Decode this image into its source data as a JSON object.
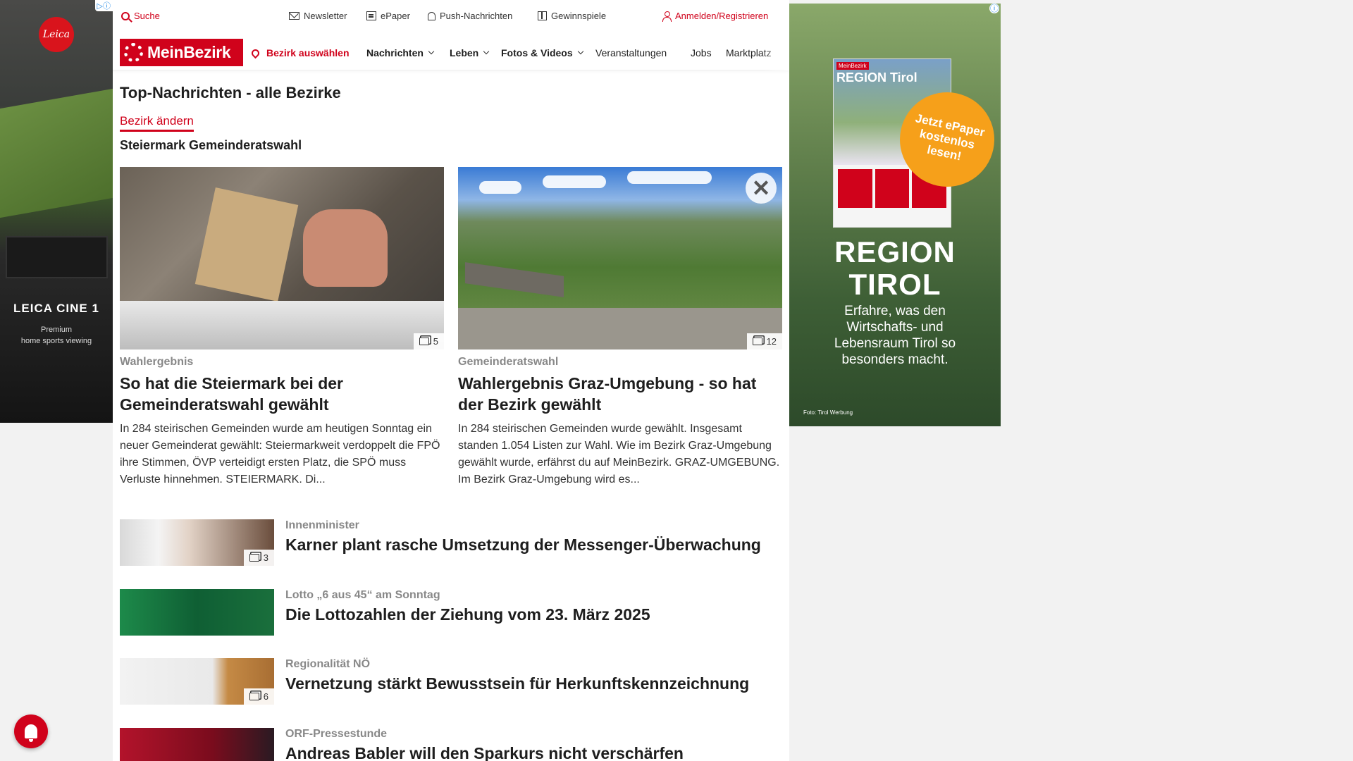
{
  "ads": {
    "left": {
      "badge": "▷ⓘ",
      "logo": "Leica",
      "title": "LEICA CINE 1",
      "subtitle_line1": "Premium",
      "subtitle_line2": "home sports viewing"
    },
    "right": {
      "badge": "ⓘ",
      "magazine_brand": "MeinBezirk",
      "magazine_title": "REGION Tirol",
      "cta": "Jetzt ePaper kostenlos lesen!",
      "headline_line1": "REGION",
      "headline_line2": "TIROL",
      "sub": "Erfahre, was den Wirtschafts- und Lebensraum Tirol so besonders macht.",
      "credit": "Foto: Tirol Werbung"
    }
  },
  "utility": {
    "search": "Suche",
    "newsletter": "Newsletter",
    "epaper": "ePaper",
    "push": "Push-Nachrichten",
    "gewinnspiele": "Gewinnspiele",
    "login": "Anmelden/Registrieren"
  },
  "nav": {
    "logo": "MeinBezirk",
    "bezirk": "Bezirk auswählen",
    "items": [
      "Nachrichten",
      "Leben",
      "Fotos & Videos",
      "Veranstaltungen",
      "Jobs",
      "Marktplatz"
    ]
  },
  "main": {
    "title": "Top-Nachrichten - alle Bezirke",
    "change_link": "Bezirk ändern",
    "section": "Steiermark Gemeinderatswahl",
    "cards": [
      {
        "kicker": "Wahlergebnis",
        "headline": "So hat die Steiermark bei der Gemeinderatswahl gewählt",
        "teaser": "In 284 steirischen Gemeinden wurde am heutigen Sonntag ein neuer Gemeinderat gewählt: Steiermarkweit verdoppelt die FPÖ ihre Stimmen, ÖVP verteidigt ersten Platz, die SPÖ muss Verluste hinnehmen.  STEIERMARK. Di...",
        "images": "5"
      },
      {
        "kicker": "Gemeinderatswahl",
        "headline": "Wahlergebnis Graz-Umgebung - so hat der Bezirk gewählt",
        "teaser": "In 284 steirischen Gemeinden wurde gewählt. Insgesamt standen 1.054 Listen zur Wahl. Wie im Bezirk Graz-Umgebung gewählt wurde, erfährst du auf MeinBezirk. GRAZ-UMGEBUNG. Im Bezirk Graz-Umgebung wird es...",
        "images": "12"
      }
    ],
    "list": [
      {
        "kicker": "Innenminister",
        "headline": "Karner plant rasche Umsetzung der Messenger-Überwachung",
        "images": "3"
      },
      {
        "kicker": "Lotto „6 aus 45“ am Sonntag",
        "headline": "Die Lottozahlen der Ziehung vom 23. März 2025",
        "images": ""
      },
      {
        "kicker": "Regionalität NÖ",
        "headline": "Vernetzung stärkt Bewusstsein für Herkunftskennzeichnung",
        "images": "6"
      },
      {
        "kicker": "ORF-Pressestunde",
        "headline": "Andreas Babler will den Sparkurs nicht verschärfen",
        "images": ""
      }
    ]
  },
  "colors": {
    "brand": "#d0021b",
    "kicker": "#888888"
  }
}
